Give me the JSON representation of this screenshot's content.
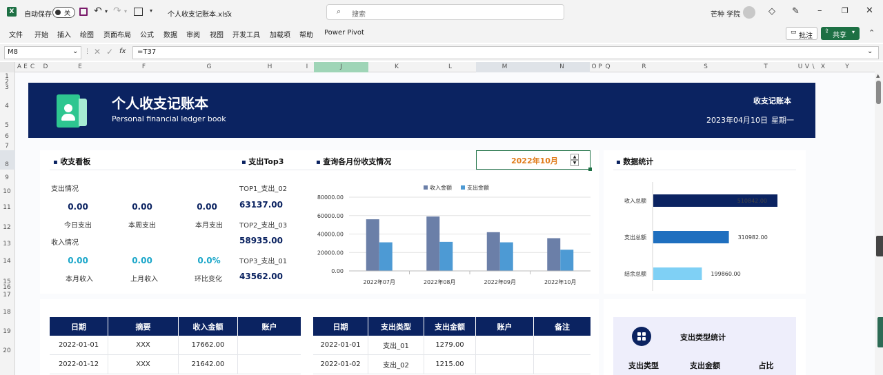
{
  "titlebar": {
    "autosave_label": "自动保存",
    "autosave_state": "关",
    "filename": "个人收支记账本.xlsx",
    "search_placeholder": "搜索",
    "user_name": "芒种 学院"
  },
  "ribbon": {
    "tabs": [
      "文件",
      "开始",
      "插入",
      "绘图",
      "页面布局",
      "公式",
      "数据",
      "审阅",
      "视图",
      "开发工具",
      "加载项",
      "帮助",
      "Power Pivot"
    ],
    "comment_label": "批注",
    "share_label": "共享"
  },
  "formula_bar": {
    "name_box": "M8",
    "fx": "fx",
    "formula": "=T37"
  },
  "columns": [
    "A",
    "E",
    "C",
    "D",
    "E",
    "F",
    "G",
    "H",
    "I",
    "J",
    "K",
    "L",
    "M",
    "N",
    "O",
    "P",
    "Q",
    "R",
    "S",
    "T",
    "U",
    "V",
    "\\",
    "X",
    "Y"
  ],
  "rows": [
    "1",
    "2",
    "3",
    "4",
    "5",
    "6",
    "7",
    "8",
    "9",
    "10",
    "11",
    "12",
    "13",
    "14",
    "15",
    "16",
    "17",
    "18",
    "19",
    "20"
  ],
  "banner": {
    "title": "个人收支记账本",
    "subtitle": "Personal financial ledger book",
    "right_title": "收支记账本",
    "date": "2023年04月10日",
    "weekday": "星期一",
    "accent": "#0b2361"
  },
  "dashboard": {
    "section_title": "收支看板",
    "expense_heading": "支出情况",
    "expense_stats": [
      {
        "value": "0.00",
        "label": "今日支出"
      },
      {
        "value": "0.00",
        "label": "本周支出"
      },
      {
        "value": "0.00",
        "label": "本月支出"
      }
    ],
    "income_heading": "收入情况",
    "income_stats": [
      {
        "value": "0.00",
        "label": "本月收入"
      },
      {
        "value": "0.00",
        "label": "上月收入"
      },
      {
        "value": "0.0%",
        "label": "环比变化"
      }
    ]
  },
  "top3": {
    "section_title": "支出Top3",
    "items": [
      {
        "label": "TOP1_支出_02",
        "value": "63137.00"
      },
      {
        "label": "TOP2_支出_03",
        "value": "58935.00"
      },
      {
        "label": "TOP3_支出_01",
        "value": "43562.00"
      }
    ]
  },
  "monthly": {
    "section_title": "查询各月份收支情况",
    "selected_month": "2022年10月",
    "month_color": "#e07b1a"
  },
  "chart_data": [
    {
      "type": "bar",
      "categories": [
        "2022年07月",
        "2022年08月",
        "2022年09月",
        "2022年10月"
      ],
      "series": [
        {
          "name": "收入金额",
          "values": [
            56000,
            59000,
            42000,
            35500
          ],
          "color": "#6b7fa8"
        },
        {
          "name": "支出金额",
          "values": [
            31000,
            31500,
            31000,
            23000
          ],
          "color": "#4d9ad4"
        }
      ],
      "yticks": [
        "80000.00",
        "60000.00",
        "40000.00",
        "20000.00",
        "0.00"
      ],
      "ylim": [
        0,
        80000
      ],
      "legend": "top-center",
      "grid": true
    },
    {
      "type": "bar",
      "orientation": "horizontal",
      "categories": [
        "收入总额",
        "支出总额",
        "结余总额"
      ],
      "values": [
        510842.0,
        310982.0,
        199860.0
      ],
      "labels": [
        "510842.00",
        "310982.00",
        "199860.00"
      ],
      "colors": [
        "#0b2361",
        "#1f6fbf",
        "#7fd0f5"
      ]
    }
  ],
  "stats": {
    "section_title": "数据统计"
  },
  "income_table": {
    "headers": [
      "日期",
      "摘要",
      "收入金额",
      "账户"
    ],
    "rows": [
      [
        "2022-01-01",
        "XXX",
        "17662.00",
        ""
      ],
      [
        "2022-01-12",
        "XXX",
        "21642.00",
        ""
      ]
    ]
  },
  "expense_table": {
    "headers": [
      "日期",
      "支出类型",
      "支出金额",
      "账户",
      "备注"
    ],
    "rows": [
      [
        "2022-01-01",
        "支出_01",
        "1279.00",
        "",
        ""
      ],
      [
        "2022-01-02",
        "支出_02",
        "1215.00",
        "",
        ""
      ]
    ]
  },
  "category_stats": {
    "title": "支出类型统计",
    "headers": [
      "支出类型",
      "支出金额",
      "占比"
    ]
  }
}
